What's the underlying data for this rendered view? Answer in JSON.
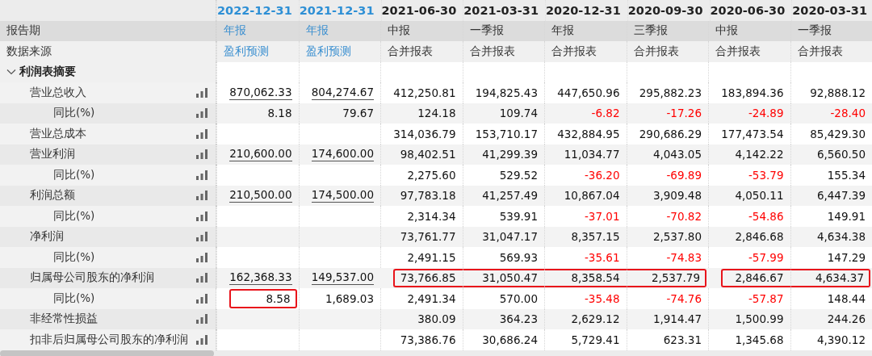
{
  "columns": [
    {
      "date": "2022-12-31",
      "period": "年报",
      "source": "盈利预测",
      "kind": "forecast"
    },
    {
      "date": "2021-12-31",
      "period": "年报",
      "source": "盈利预测",
      "kind": "forecast"
    },
    {
      "date": "2021-06-30",
      "period": "中报",
      "source": "合并报表",
      "kind": "actual"
    },
    {
      "date": "2021-03-31",
      "period": "一季报",
      "source": "合并报表",
      "kind": "actual"
    },
    {
      "date": "2020-12-31",
      "period": "年报",
      "source": "合并报表",
      "kind": "actual"
    },
    {
      "date": "2020-09-30",
      "period": "三季报",
      "source": "合并报表",
      "kind": "actual"
    },
    {
      "date": "2020-06-30",
      "period": "中报",
      "source": "合并报表",
      "kind": "actual"
    },
    {
      "date": "2020-03-31",
      "period": "一季报",
      "source": "合并报表",
      "kind": "actual"
    }
  ],
  "header_labels": {
    "period": "报告期",
    "source": "数据来源"
  },
  "section": {
    "label": "利润表摘要",
    "expanded": true,
    "rows": [
      {
        "label": "营业总收入",
        "cells": [
          "870,062.33",
          "804,274.67",
          "412,250.81",
          "194,825.43",
          "447,650.96",
          "295,882.23",
          "183,894.36",
          "92,888.12"
        ],
        "children": [
          {
            "label": "同比(%)",
            "cells": [
              "8.18",
              "79.67",
              "124.18",
              "109.74",
              {
                "text": "-6.82",
                "color": "#ff0000"
              },
              {
                "text": "-17.26",
                "color": "#ff0000"
              },
              {
                "text": "-24.89",
                "color": "#ff0000"
              },
              {
                "text": "-28.40",
                "color": "#ff0000"
              }
            ]
          }
        ]
      },
      {
        "label": "营业总成本",
        "cells": [
          null,
          null,
          "314,036.79",
          "153,710.17",
          "432,884.95",
          "290,686.29",
          "177,473.54",
          "85,429.30"
        ]
      },
      {
        "label": "营业利润",
        "cells": [
          "210,600.00",
          "174,600.00",
          "98,402.51",
          "41,299.39",
          "11,034.77",
          "4,043.05",
          "4,142.22",
          "6,560.50"
        ],
        "children": [
          {
            "label": "同比(%)",
            "cells": [
              null,
              null,
              "2,275.60",
              "529.52",
              {
                "text": "-36.20",
                "color": "#ff0000"
              },
              {
                "text": "-69.89",
                "color": "#ff0000"
              },
              {
                "text": "-53.79",
                "color": "#ff0000"
              },
              "155.34"
            ]
          }
        ]
      },
      {
        "label": "利润总额",
        "cells": [
          "210,500.00",
          "174,500.00",
          "97,783.18",
          "41,257.49",
          "10,867.04",
          "3,909.48",
          "4,050.11",
          "6,447.39"
        ],
        "children": [
          {
            "label": "同比(%)",
            "cells": [
              null,
              null,
              "2,314.34",
              "539.91",
              {
                "text": "-37.01",
                "color": "#ff0000"
              },
              {
                "text": "-70.82",
                "color": "#ff0000"
              },
              {
                "text": "-54.86",
                "color": "#ff0000"
              },
              "149.91"
            ]
          }
        ]
      },
      {
        "label": "净利润",
        "cells": [
          null,
          null,
          "73,761.77",
          "31,047.17",
          "8,357.15",
          "2,537.80",
          "2,846.68",
          "4,634.38"
        ],
        "children": [
          {
            "label": "同比(%)",
            "cells": [
              null,
              null,
              "2,491.15",
              "569.93",
              {
                "text": "-35.61",
                "color": "#ff0000"
              },
              {
                "text": "-74.83",
                "color": "#ff0000"
              },
              {
                "text": "-57.99",
                "color": "#ff0000"
              },
              "147.29"
            ]
          }
        ]
      },
      {
        "label": "归属母公司股东的净利润",
        "cells": [
          "162,368.33",
          "149,537.00",
          {
            "text": "73,766.85",
            "boxed": true,
            "box_start": true
          },
          {
            "text": "31,050.47",
            "boxed": true,
            "box_start": false
          },
          {
            "text": "8,358.54",
            "boxed": true,
            "box_start": false
          },
          {
            "text": "2,537.79",
            "boxed": true,
            "box_start": false
          },
          {
            "text": "2,846.67",
            "boxed": true,
            "box_start": true
          },
          {
            "text": "4,634.37",
            "boxed": true,
            "box_start": false
          }
        ],
        "children": [
          {
            "label": "同比(%)",
            "cells": [
              {
                "text": "8.58",
                "boxed": true,
                "box_start": true
              },
              "1,689.03",
              "2,491.34",
              "570.00",
              {
                "text": "-35.48",
                "color": "#ff0000"
              },
              {
                "text": "-74.76",
                "color": "#ff0000"
              },
              {
                "text": "-57.87",
                "color": "#ff0000"
              },
              "148.44"
            ]
          }
        ]
      },
      {
        "label": "非经常性损益",
        "cells": [
          null,
          null,
          "380.09",
          "364.23",
          "2,629.12",
          "1,914.47",
          "1,500.99",
          "244.26"
        ]
      },
      {
        "label": "扣非后归属母公司股东的净利润",
        "cells": [
          null,
          null,
          "73,386.76",
          "30,686.24",
          "5,729.41",
          "623.31",
          "1,345.68",
          "4,390.12"
        ]
      }
    ]
  }
}
